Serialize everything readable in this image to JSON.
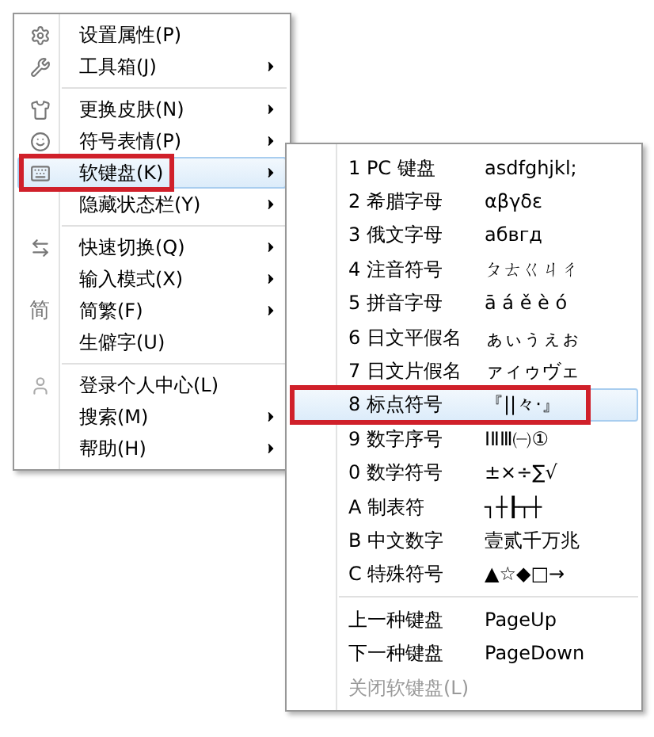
{
  "main_menu": {
    "items": [
      {
        "kind": "item",
        "label": "设置属性(P)",
        "has_submenu": false,
        "selected": false
      },
      {
        "kind": "item",
        "label": "工具箱(J)",
        "has_submenu": true,
        "selected": false
      },
      {
        "kind": "separator"
      },
      {
        "kind": "item",
        "label": "更换皮肤(N)",
        "has_submenu": true,
        "selected": false
      },
      {
        "kind": "item",
        "label": "符号表情(P)",
        "has_submenu": true,
        "selected": false
      },
      {
        "kind": "item",
        "label": "软键盘(K)",
        "has_submenu": true,
        "selected": true
      },
      {
        "kind": "item",
        "label": "隐藏状态栏(Y)",
        "has_submenu": true,
        "selected": false
      },
      {
        "kind": "separator"
      },
      {
        "kind": "item",
        "label": "快速切换(Q)",
        "has_submenu": true,
        "selected": false
      },
      {
        "kind": "item",
        "label": "输入模式(X)",
        "has_submenu": true,
        "selected": false
      },
      {
        "kind": "item",
        "icon_text": "简",
        "label": "简繁(F)",
        "has_submenu": true,
        "selected": false
      },
      {
        "kind": "item",
        "label": "生僻字(U)",
        "has_submenu": false,
        "selected": false
      },
      {
        "kind": "separator"
      },
      {
        "kind": "item",
        "label": "登录个人中心(L)",
        "has_submenu": false,
        "selected": false
      },
      {
        "kind": "item",
        "label": "搜索(M)",
        "has_submenu": true,
        "selected": false
      },
      {
        "kind": "item",
        "label": "帮助(H)",
        "has_submenu": true,
        "selected": false
      }
    ]
  },
  "submenu": {
    "items": [
      {
        "kind": "item",
        "label": "1 PC 键盘",
        "sample": "asdfghjkl;",
        "selected": false,
        "disabled": false
      },
      {
        "kind": "item",
        "label": "2 希腊字母",
        "sample": "αβγδε",
        "selected": false,
        "disabled": false
      },
      {
        "kind": "item",
        "label": "3 俄文字母",
        "sample": "абвгд",
        "selected": false,
        "disabled": false
      },
      {
        "kind": "item",
        "label": "4 注音符号",
        "sample": "ㄆㄊㄍㄐㄔ",
        "selected": false,
        "disabled": false
      },
      {
        "kind": "item",
        "label": "5 拼音字母",
        "sample": "ā á ě è ó",
        "selected": false,
        "disabled": false
      },
      {
        "kind": "item",
        "label": "6 日文平假名",
        "sample": "ぁぃぅぇぉ",
        "selected": false,
        "disabled": false
      },
      {
        "kind": "item",
        "label": "7 日文片假名",
        "sample": "ァィゥヴェ",
        "selected": false,
        "disabled": false
      },
      {
        "kind": "item",
        "label": "8 标点符号",
        "sample": "『||々·』",
        "selected": true,
        "disabled": false
      },
      {
        "kind": "item",
        "label": "9 数字序号",
        "sample": "ⅠⅡⅢ㈠①",
        "selected": false,
        "disabled": false
      },
      {
        "kind": "item",
        "label": "0 数学符号",
        "sample": "±×÷∑√",
        "selected": false,
        "disabled": false
      },
      {
        "kind": "item",
        "label": "A 制表符",
        "sample": "┐┼┠┬┼",
        "selected": false,
        "disabled": false
      },
      {
        "kind": "item",
        "label": "B 中文数字",
        "sample": "壹贰千万兆",
        "selected": false,
        "disabled": false
      },
      {
        "kind": "item",
        "label": "C 特殊符号",
        "sample": "▲☆◆□→",
        "selected": false,
        "disabled": false
      },
      {
        "kind": "separator"
      },
      {
        "kind": "item",
        "label": "上一种键盘",
        "sample": "PageUp",
        "selected": false,
        "disabled": false
      },
      {
        "kind": "item",
        "label": "下一种键盘",
        "sample": "PageDown",
        "selected": false,
        "disabled": false
      },
      {
        "kind": "item",
        "label": "关闭软键盘(L)",
        "selected": false,
        "disabled": true
      }
    ]
  }
}
